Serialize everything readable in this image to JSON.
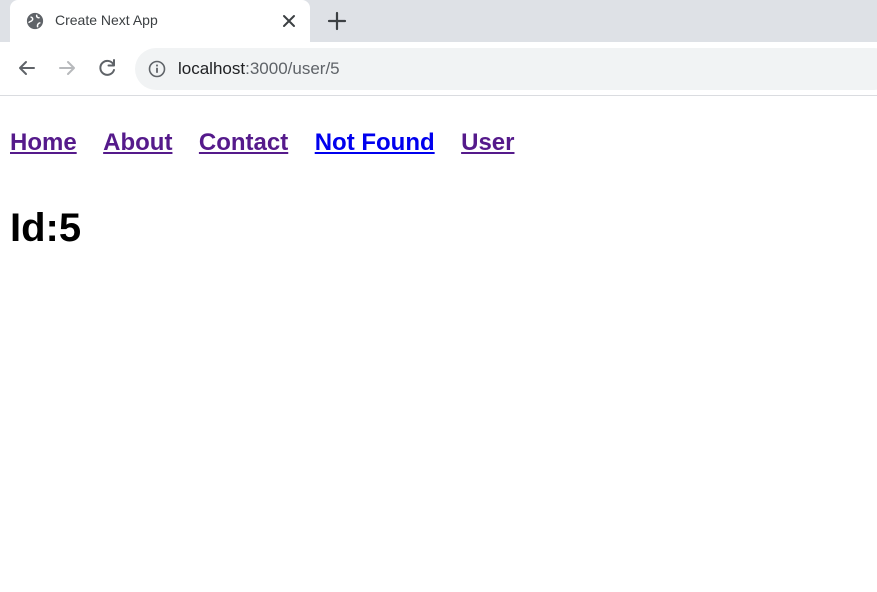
{
  "browser": {
    "tab": {
      "title": "Create Next App",
      "favicon_icon": "globe-icon",
      "close_icon": "close-icon"
    },
    "new_tab_icon": "plus-icon",
    "toolbar": {
      "back_icon": "arrow-left-icon",
      "forward_icon": "arrow-right-icon",
      "reload_icon": "reload-icon",
      "site_info_icon": "info-icon"
    },
    "address": {
      "host": "localhost",
      "path": ":3000/user/5"
    }
  },
  "page": {
    "nav_links": [
      {
        "label": "Home",
        "visited": true
      },
      {
        "label": "About",
        "visited": true
      },
      {
        "label": "Contact",
        "visited": true
      },
      {
        "label": "Not Found",
        "visited": false
      },
      {
        "label": "User",
        "visited": true
      }
    ],
    "heading": "Id:5"
  },
  "colors": {
    "tabstrip_bg": "#dee1e6",
    "omnibox_bg": "#f1f3f4",
    "link_visited": "#551a8b",
    "link_unvisited": "#0000ee"
  }
}
